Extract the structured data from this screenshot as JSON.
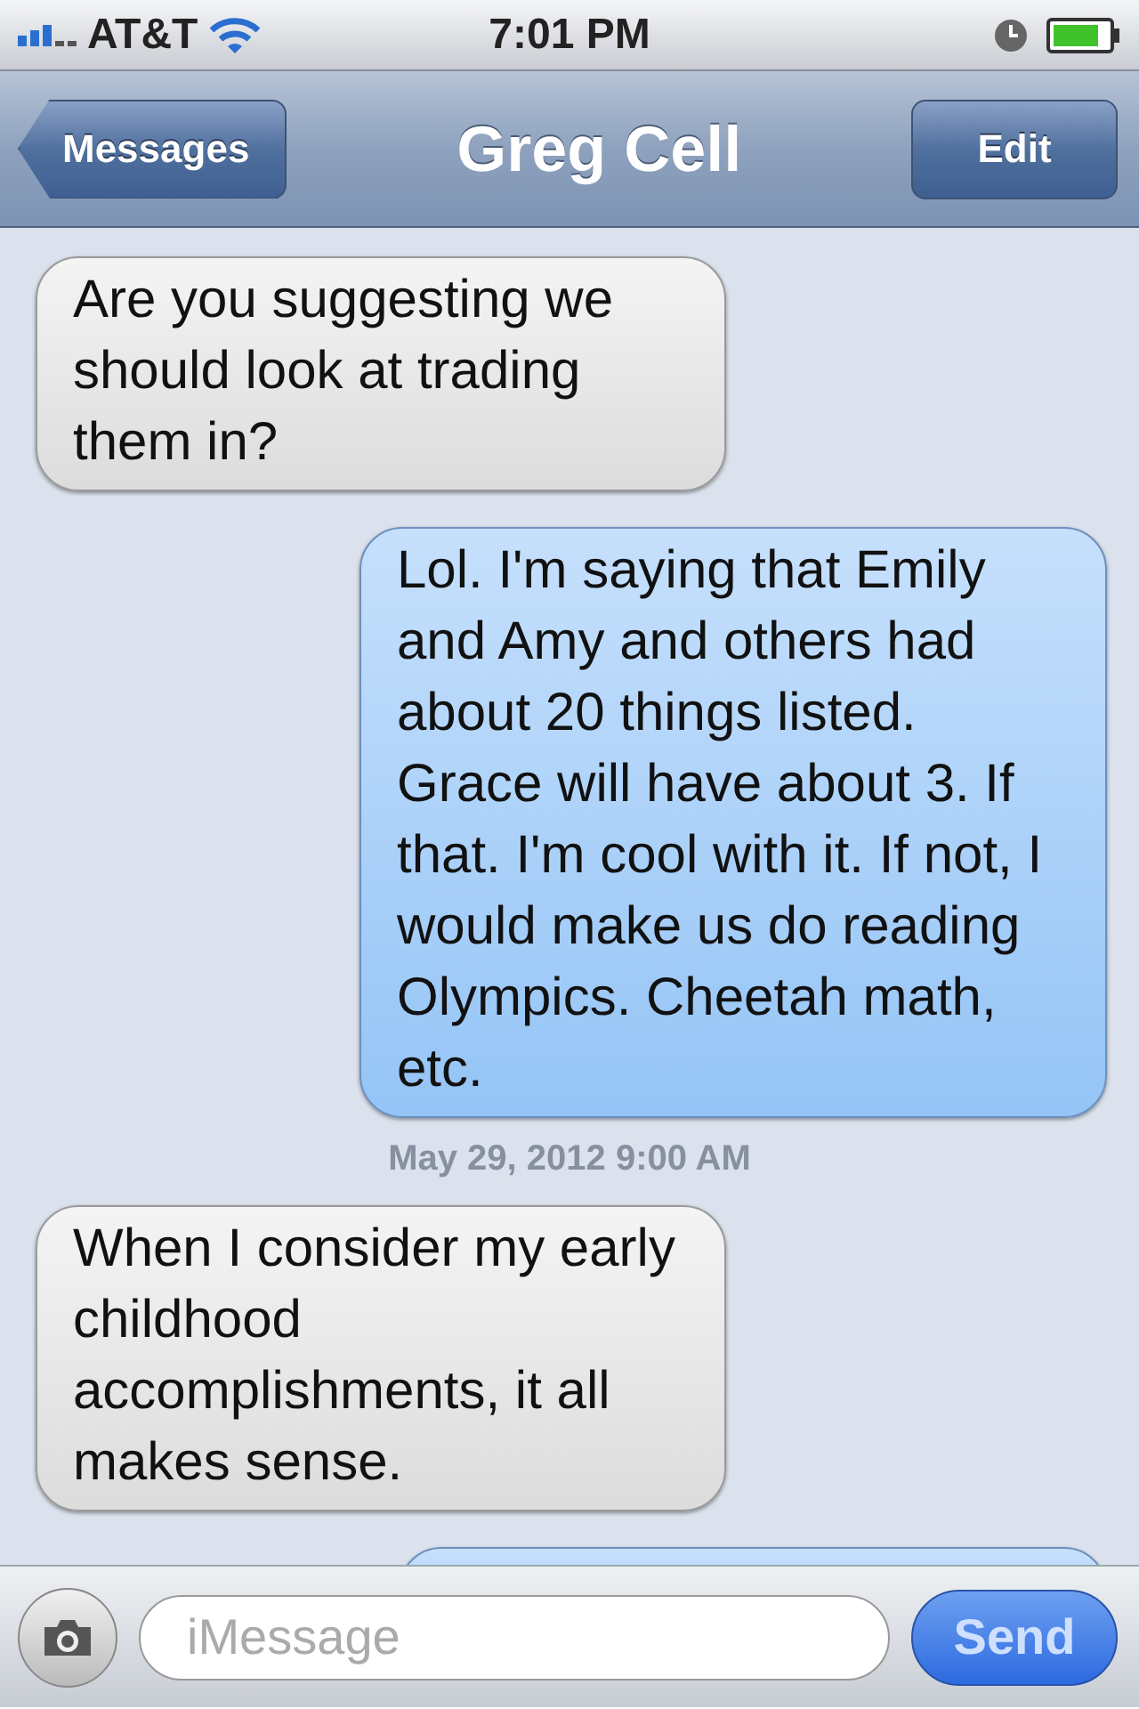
{
  "status_bar": {
    "carrier": "AT&T",
    "time": "7:01 PM"
  },
  "nav": {
    "back": "Messages",
    "title": "Greg Cell",
    "edit": "Edit"
  },
  "messages": [
    {
      "kind": "incoming",
      "text": "Are you suggesting we should look at trading them in?"
    },
    {
      "kind": "outgoing",
      "text": "Lol. I'm saying that Emily and Amy and others had about 20 things listed. Grace will have about 3. If that. I'm cool with it. If not, I would make us do reading Olympics. Cheetah math, etc."
    },
    {
      "kind": "timestamp",
      "text": "May 29, 2012 9:00 AM"
    },
    {
      "kind": "incoming",
      "text": "When I consider my early childhood accomplishments, it all makes sense."
    },
    {
      "kind": "outgoing"
    }
  ],
  "composer": {
    "placeholder": "iMessage",
    "send": "Send"
  }
}
